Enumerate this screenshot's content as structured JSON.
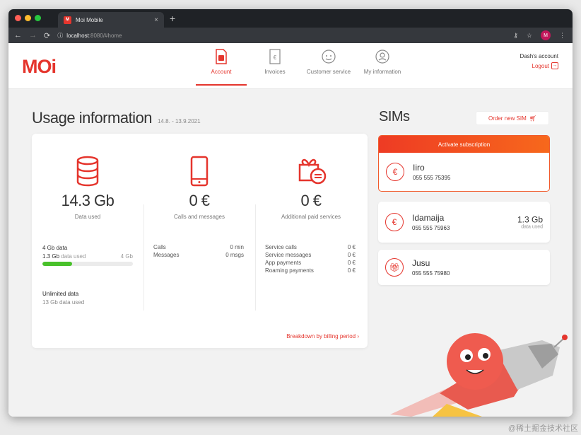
{
  "browser": {
    "tab_title": "Moi Mobile",
    "favicon_text": "M",
    "url_host": "localhost",
    "url_rest": ":8080/#home",
    "profile_initial": "M"
  },
  "header": {
    "logo": "MOi",
    "nav": [
      {
        "label": "Account"
      },
      {
        "label": "Invoices"
      },
      {
        "label": "Customer service"
      },
      {
        "label": "My information"
      }
    ],
    "account_name": "Dash's account",
    "logout_label": "Logout"
  },
  "usage": {
    "title": "Usage information",
    "dates": "14.8. - 13.9.2021",
    "data_value": "14.3 Gb",
    "data_sub": "Data used",
    "calls_value": "0 €",
    "calls_sub": "Calls and messages",
    "paid_value": "0 €",
    "paid_sub": "Additional paid services",
    "data_plan_title": "4 Gb data",
    "data_plan_used": "1.3 Gb",
    "data_plan_used_label": "data used",
    "data_plan_total": "4 Gb",
    "data_plan_fraction": 0.325,
    "unlimited_title": "Unlimited data",
    "unlimited_used": "13 Gb",
    "unlimited_used_label": "data used",
    "calls_rows": [
      {
        "label": "Calls",
        "value": "0 min"
      },
      {
        "label": "Messages",
        "value": "0 msgs"
      }
    ],
    "paid_rows": [
      {
        "label": "Service calls",
        "value": "0 €"
      },
      {
        "label": "Service messages",
        "value": "0 €"
      },
      {
        "label": "App payments",
        "value": "0 €"
      },
      {
        "label": "Roaming payments",
        "value": "0 €"
      }
    ],
    "breakdown_link": "Breakdown by billing period"
  },
  "sims": {
    "title": "SIMs",
    "order_label": "Order new SIM",
    "activate_label": "Activate subscription",
    "list": [
      {
        "name": "Iiro",
        "number": "055 555 75395",
        "usage": "",
        "usage_label": ""
      },
      {
        "name": "Idamaija",
        "number": "055 555 75963",
        "usage": "1.3 Gb",
        "usage_label": "data used"
      },
      {
        "name": "Jusu",
        "number": "055 555 75980",
        "usage": "",
        "usage_label": ""
      }
    ]
  },
  "watermark": "@稀土掘金技术社区",
  "colors": {
    "accent": "#e5352d",
    "progress": "#48c12a"
  }
}
